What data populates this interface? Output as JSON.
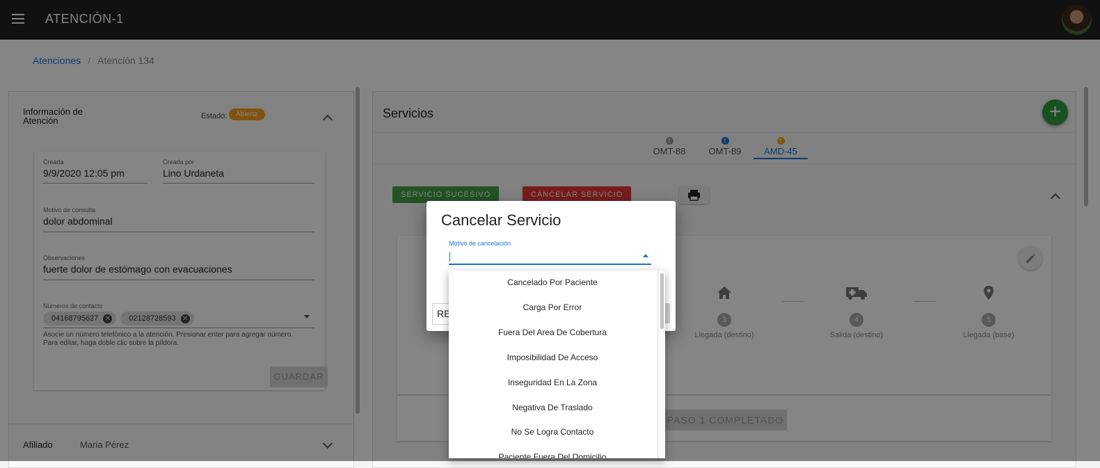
{
  "app": {
    "title": "ATENCIÓN-1"
  },
  "breadcrumb": {
    "root": "Atenciones",
    "separator": "/",
    "current": "Atención 134"
  },
  "info": {
    "title": "Información de Atención",
    "estado_label": "Estado:",
    "estado_value": "Abierta",
    "creada_label": "Creada",
    "creada_value": "9/9/2020 12:05 pm",
    "creada_por_label": "Creada por",
    "creada_por_value": "Lino Urdaneta",
    "motivo_label": "Motivo de consulta",
    "motivo_value": "dolor abdominal",
    "obs_label": "Observaciones",
    "obs_value": "fuerte dolor de estómago con evacuaciones",
    "contactos_label": "Números de contacto",
    "contactos": [
      "04168795627",
      "02128728593"
    ],
    "help_line1": "Asocie un número telefónico a la atención. Presionar enter para agregar número.",
    "help_line2": "Para editar, haga doble clic sobre la píldora.",
    "guardar_label": "GUARDAR"
  },
  "afiliado": {
    "label": "Afiliado",
    "value": "Maria Pérez"
  },
  "servicios": {
    "title": "Servicios",
    "tabs": [
      {
        "label": "OMT-88",
        "color": "#9e9e9e"
      },
      {
        "label": "OMT-89",
        "color": "#1976d2"
      },
      {
        "label": "AMD-45",
        "color": "#f7a21b"
      }
    ],
    "btn_sucesivo": "SERVICIO SUCESIVO",
    "btn_cancelar": "CANCELAR SERVICIO",
    "steps": [
      {
        "num": "3",
        "label": "Llegada (destino)"
      },
      {
        "num": "4",
        "label": "Salida (destino)"
      },
      {
        "num": "5",
        "label": "Llegada (base)"
      }
    ],
    "paso_label": "PASO 1 COMPLETADO"
  },
  "dialog": {
    "title": "Cancelar Servicio",
    "select_label": "Motivo de cancelación",
    "left_button": "RE",
    "options": [
      "Cancelado Por Paciente",
      "Carga Por Error",
      "Fuera Del Area De Cobertura",
      "Imposibilidad De Acceso",
      "Inseguridad En La Zona",
      "Negativa De Traslado",
      "No Se Logra Contacto",
      "Paciente Fuera Del Domicilio"
    ]
  }
}
